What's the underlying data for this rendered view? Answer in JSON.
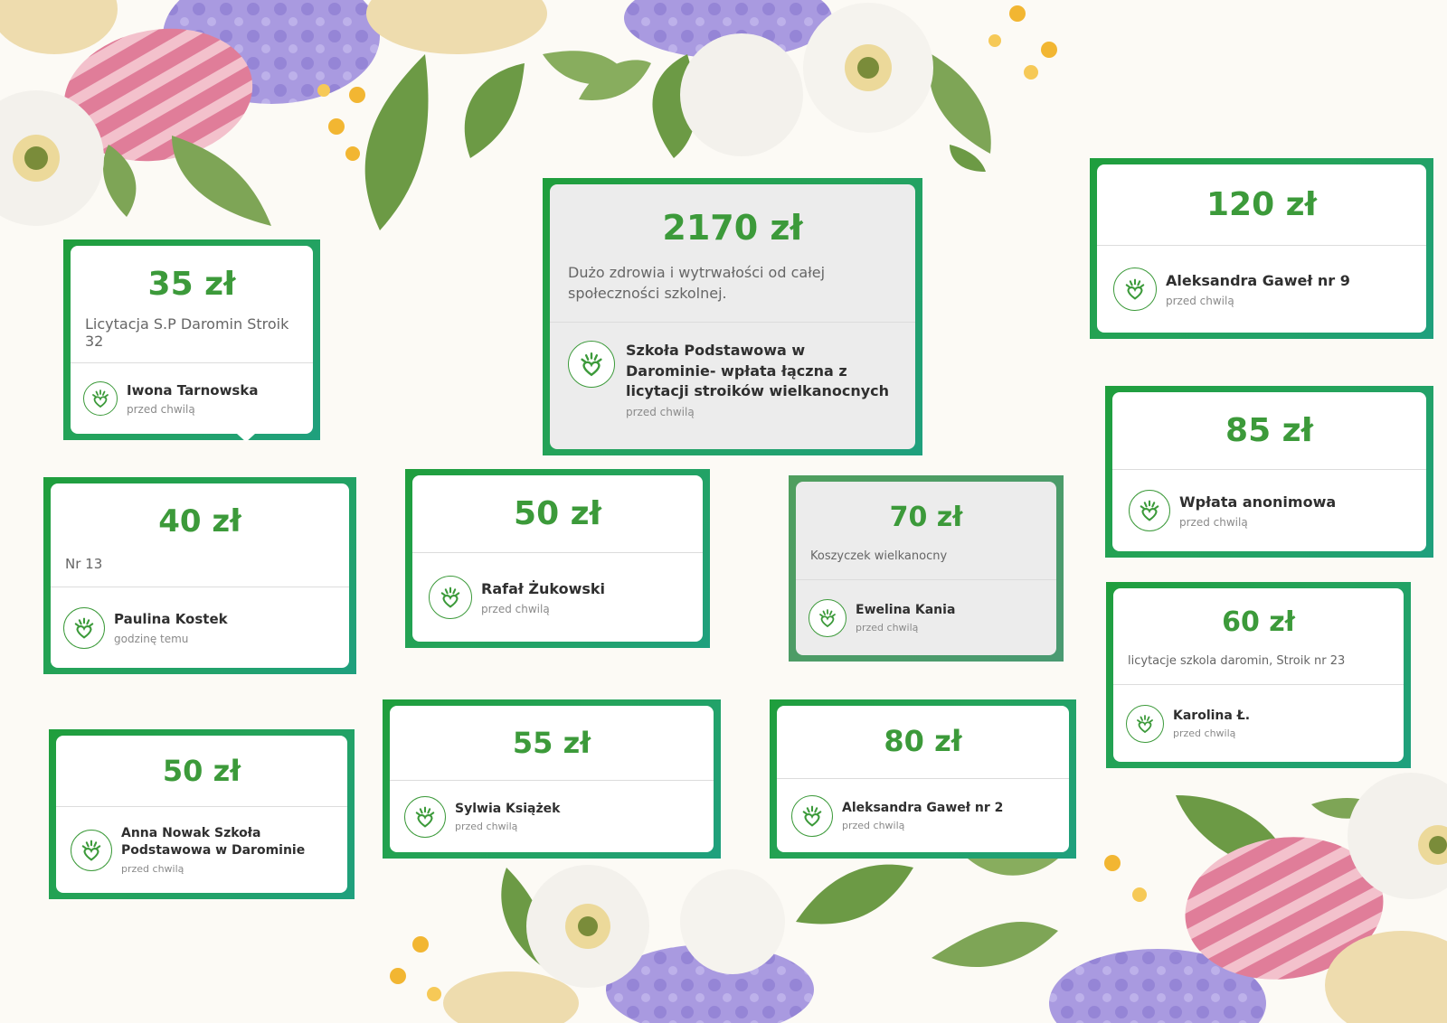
{
  "colors": {
    "accent": "#3c9a3a",
    "frame_start": "#1f9e3c",
    "frame_end": "#1fa07e",
    "page_background": "#fcfaf5"
  },
  "icon": "heart-hand-logo-icon",
  "donations": [
    {
      "id": "d1",
      "amount": "35 zł",
      "message": "Licytacja S.P Daromin Stroik 32",
      "donor": "Iwona Tarnowska",
      "time": "przed chwilą"
    },
    {
      "id": "d2",
      "amount": "2170 zł",
      "message": "Dużo zdrowia i wytrwałości od całej społeczności szkolnej.",
      "donor": "Szkoła Podstawowa w Darominie- wpłata łączna z licytacji stroików wielkanocnych",
      "time": "przed chwilą"
    },
    {
      "id": "d3",
      "amount": "120 zł",
      "donor": "Aleksandra Gaweł nr 9",
      "time": "przed chwilą"
    },
    {
      "id": "d4",
      "amount": "85 zł",
      "donor": "Wpłata anonimowa",
      "time": "przed chwilą"
    },
    {
      "id": "d5",
      "amount": "40 zł",
      "message": "Nr 13",
      "donor": "Paulina Kostek",
      "time": "godzinę temu"
    },
    {
      "id": "d6",
      "amount": "50 zł",
      "donor": "Rafał Żukowski",
      "time": "przed chwilą"
    },
    {
      "id": "d7",
      "amount": "70 zł",
      "message": "Koszyczek wielkanocny",
      "donor": "Ewelina Kania",
      "time": "przed chwilą"
    },
    {
      "id": "d8",
      "amount": "60 zł",
      "message": "licytacje szkola daromin, Stroik nr 23",
      "donor": "Karolina Ł.",
      "time": "przed chwilą"
    },
    {
      "id": "d9",
      "amount": "50 zł",
      "donor": "Anna Nowak Szkoła Podstawowa w Darominie",
      "time": "przed chwilą"
    },
    {
      "id": "d10",
      "amount": "55 zł",
      "donor": "Sylwia Książek",
      "time": "przed chwilą"
    },
    {
      "id": "d11",
      "amount": "80 zł",
      "donor": "Aleksandra Gaweł nr 2",
      "time": "przed chwilą"
    }
  ]
}
